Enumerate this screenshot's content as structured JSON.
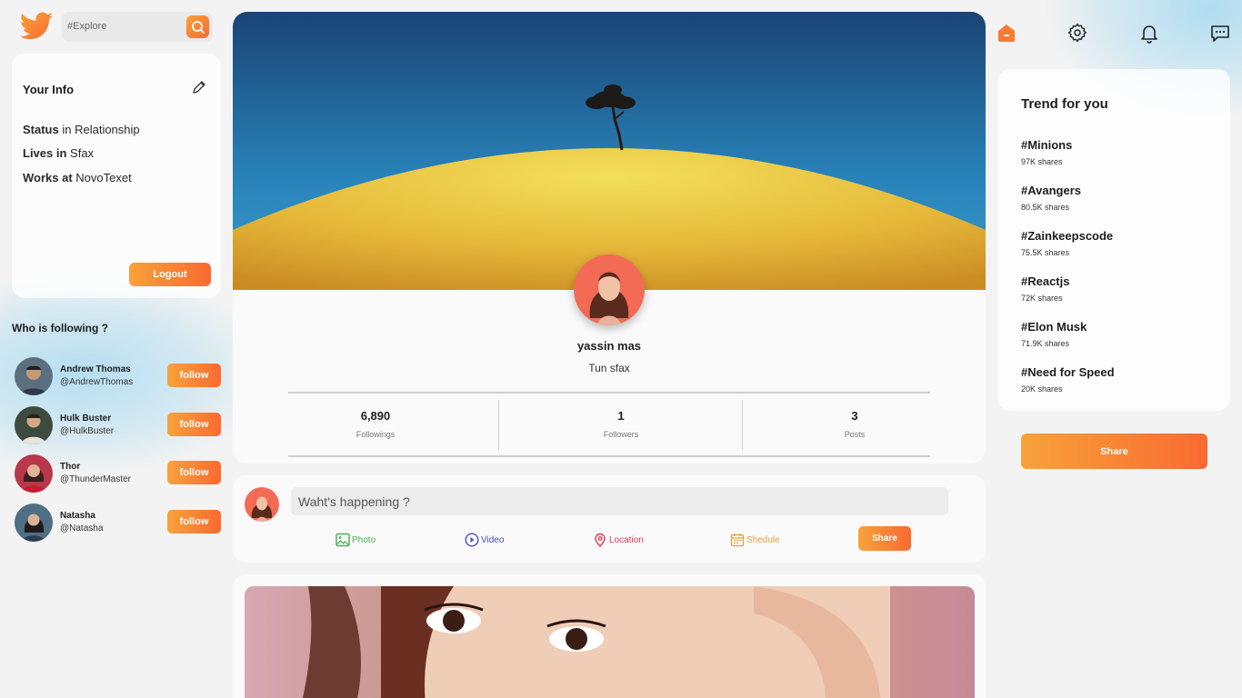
{
  "brand": {
    "accent_start": "#f8a23a",
    "accent_end": "#f96a31",
    "logo_icon": "twitter-bird-icon"
  },
  "search": {
    "placeholder": "#Explore",
    "icon": "search-icon"
  },
  "your_info": {
    "title": "Your Info",
    "edit_icon": "pencil-icon",
    "status_label": "Status",
    "status_value": "in Relationship",
    "lives_label": "Lives in",
    "lives_value": "Sfax",
    "works_label": "Works at",
    "works_value": "NovoTexet",
    "logout_label": "Logout"
  },
  "who_following": {
    "title": "Who is following ?",
    "people": [
      {
        "name": "Andrew Thomas",
        "handle": "@AndrewThomas",
        "button": "follow"
      },
      {
        "name": "Hulk Buster",
        "handle": "@HulkBuster",
        "button": "follow"
      },
      {
        "name": "Thor",
        "handle": "@ThunderMaster",
        "button": "follow"
      },
      {
        "name": "Natasha",
        "handle": "@Natasha",
        "button": "follow"
      }
    ]
  },
  "profile": {
    "name": "yassin mas",
    "location": "Tun sfax",
    "stats": [
      {
        "value": "6,890",
        "label": "Followings"
      },
      {
        "value": "1",
        "label": "Followers"
      },
      {
        "value": "3",
        "label": "Posts"
      }
    ]
  },
  "composer": {
    "placeholder": "Waht's happening ?",
    "options": [
      {
        "label": "Photo",
        "icon": "image-icon",
        "color": "#4caf50"
      },
      {
        "label": "Video",
        "icon": "play-circle-icon",
        "color": "#4a4fb8"
      },
      {
        "label": "Location",
        "icon": "map-pin-icon",
        "color": "#e53950"
      },
      {
        "label": "Shedule",
        "icon": "calendar-icon",
        "color": "#e2a03a"
      }
    ],
    "share_label": "Share"
  },
  "top_nav": {
    "icons": [
      "home-icon",
      "gear-icon",
      "bell-icon",
      "chat-icon"
    ]
  },
  "trends": {
    "title": "Trend for you",
    "items": [
      {
        "tag": "#Minions",
        "shares": "97K shares"
      },
      {
        "tag": "#Avangers",
        "shares": "80.5K shares"
      },
      {
        "tag": "#Zainkeepscode",
        "shares": "75.5K shares"
      },
      {
        "tag": "#Reactjs",
        "shares": "72K shares"
      },
      {
        "tag": "#Elon Musk",
        "shares": "71.9K shares"
      },
      {
        "tag": "#Need for Speed",
        "shares": "20K shares"
      }
    ],
    "share_label": "Share"
  }
}
